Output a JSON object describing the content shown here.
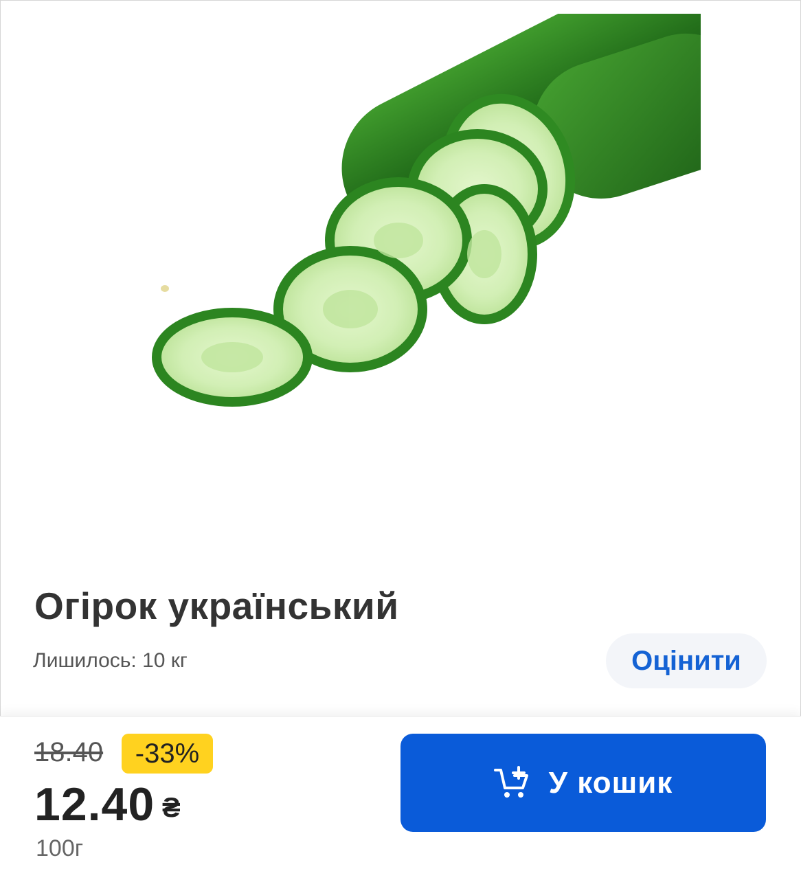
{
  "product": {
    "title": "Огірок український",
    "stock_text": "Лишилось: 10 кг",
    "rate_label": "Оцінити",
    "image_icon": "cucumber-image"
  },
  "pricing": {
    "old_price": "18.40",
    "discount": "-33%",
    "price": "12.40",
    "currency": "₴",
    "unit": "100г"
  },
  "cart": {
    "button_label": "У кошик",
    "icon": "add-to-cart-icon"
  },
  "colors": {
    "accent": "#0a5bd9",
    "rate_text": "#1462d4",
    "badge": "#ffd21f",
    "cucumber_dark": "#1f6b1a",
    "cucumber_flesh": "#cdeeb0"
  }
}
